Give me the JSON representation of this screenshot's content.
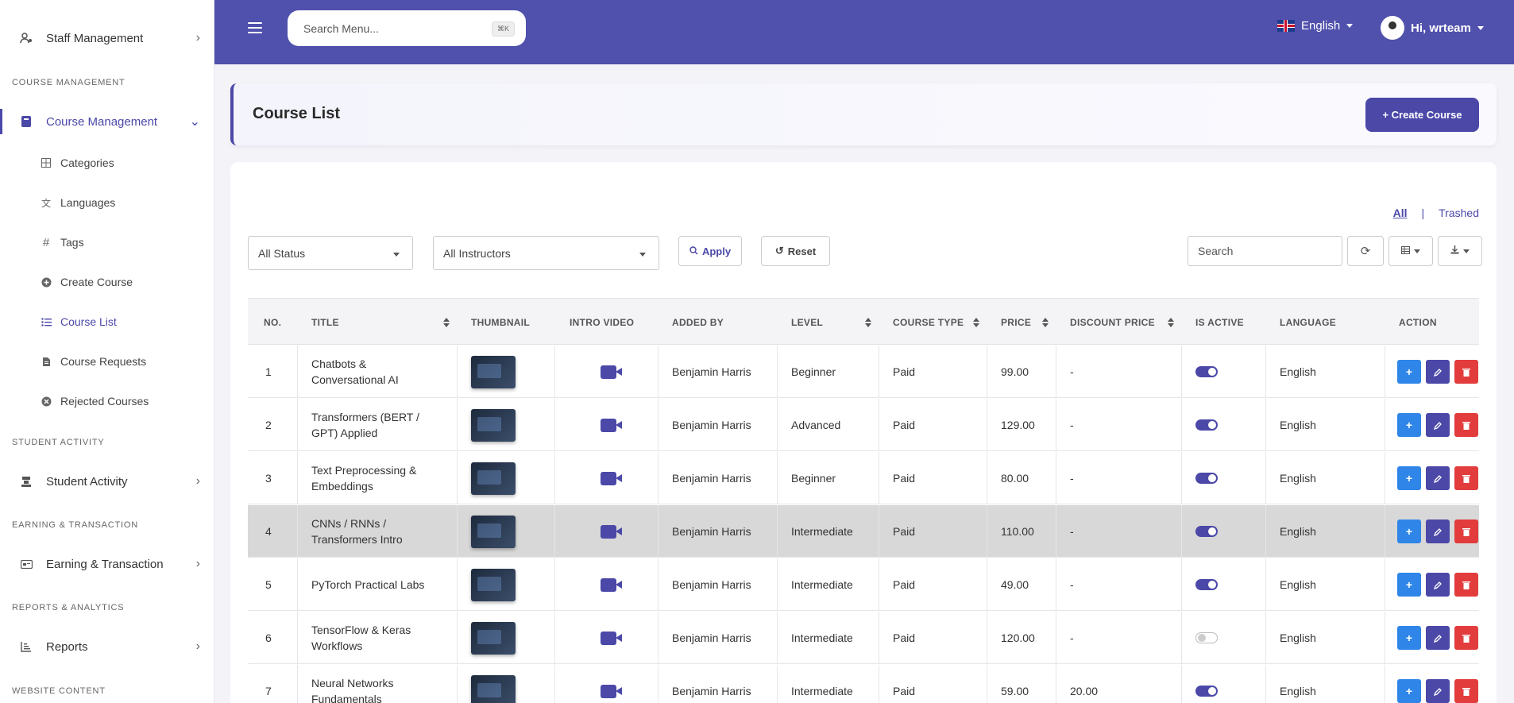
{
  "sidebar": {
    "top_item": {
      "label": "Staff Management",
      "icon": "staff-icon"
    },
    "sections": [
      {
        "title": "COURSE MANAGEMENT"
      },
      {
        "title": "STUDENT ACTIVITY"
      },
      {
        "title": "EARNING & TRANSACTION"
      },
      {
        "title": "REPORTS & ANALYTICS"
      },
      {
        "title": "WEBSITE CONTENT"
      }
    ],
    "course_management": {
      "label": "Course Management"
    },
    "sub_items": [
      {
        "label": "Categories",
        "icon": "grid-icon"
      },
      {
        "label": "Languages",
        "icon": "translate-icon"
      },
      {
        "label": "Tags",
        "icon": "hash-icon"
      },
      {
        "label": "Create Course",
        "icon": "plus-circle-icon"
      },
      {
        "label": "Course List",
        "icon": "list-icon"
      },
      {
        "label": "Course Requests",
        "icon": "file-icon"
      },
      {
        "label": "Rejected Courses",
        "icon": "x-circle-icon"
      }
    ],
    "student_activity": {
      "label": "Student Activity"
    },
    "earning": {
      "label": "Earning & Transaction"
    },
    "reports": {
      "label": "Reports"
    }
  },
  "header": {
    "search_placeholder": "Search Menu...",
    "shortcut": "⌘K",
    "language": "English",
    "greeting": "Hi, wrteam"
  },
  "page": {
    "title": "Course List",
    "create_button": "+ Create Course"
  },
  "filters": {
    "tab_all": "All",
    "tab_separator": "|",
    "tab_trashed": "Trashed",
    "status": "All Status",
    "instructors": "All Instructors",
    "apply": "Apply",
    "reset": "Reset",
    "search": "Search"
  },
  "table": {
    "headers": [
      "NO.",
      "TITLE",
      "THUMBNAIL",
      "INTRO VIDEO",
      "ADDED BY",
      "LEVEL",
      "COURSE TYPE",
      "PRICE",
      "DISCOUNT PRICE",
      "IS ACTIVE",
      "LANGUAGE",
      "ACTION"
    ],
    "rows": [
      {
        "no": "1",
        "title1": "Chatbots &",
        "title2": "Conversational AI",
        "added_by": "Benjamin Harris",
        "level": "Beginner",
        "type": "Paid",
        "price": "99.00",
        "discount": "-",
        "active": true,
        "language": "English"
      },
      {
        "no": "2",
        "title1": "Transformers (BERT /",
        "title2": "GPT) Applied",
        "added_by": "Benjamin Harris",
        "level": "Advanced",
        "type": "Paid",
        "price": "129.00",
        "discount": "-",
        "active": true,
        "language": "English"
      },
      {
        "no": "3",
        "title1": "Text Preprocessing &",
        "title2": "Embeddings",
        "added_by": "Benjamin Harris",
        "level": "Beginner",
        "type": "Paid",
        "price": "80.00",
        "discount": "-",
        "active": true,
        "language": "English"
      },
      {
        "no": "4",
        "title1": "CNNs / RNNs /",
        "title2": "Transformers Intro",
        "added_by": "Benjamin Harris",
        "level": "Intermediate",
        "type": "Paid",
        "price": "110.00",
        "discount": "-",
        "active": true,
        "language": "English"
      },
      {
        "no": "5",
        "title1": "PyTorch Practical Labs",
        "title2": "",
        "added_by": "Benjamin Harris",
        "level": "Intermediate",
        "type": "Paid",
        "price": "49.00",
        "discount": "-",
        "active": true,
        "language": "English"
      },
      {
        "no": "6",
        "title1": "TensorFlow & Keras",
        "title2": "Workflows",
        "added_by": "Benjamin Harris",
        "level": "Intermediate",
        "type": "Paid",
        "price": "120.00",
        "discount": "-",
        "active": false,
        "language": "English"
      },
      {
        "no": "7",
        "title1": "Neural Networks",
        "title2": "Fundamentals",
        "added_by": "Benjamin Harris",
        "level": "Intermediate",
        "type": "Paid",
        "price": "59.00",
        "discount": "20.00",
        "active": true,
        "language": "English"
      }
    ]
  },
  "colors": {
    "brand": "#5050ad",
    "accent": "#4b48a8",
    "blue": "#2f86e8",
    "red": "#e23c3c"
  }
}
